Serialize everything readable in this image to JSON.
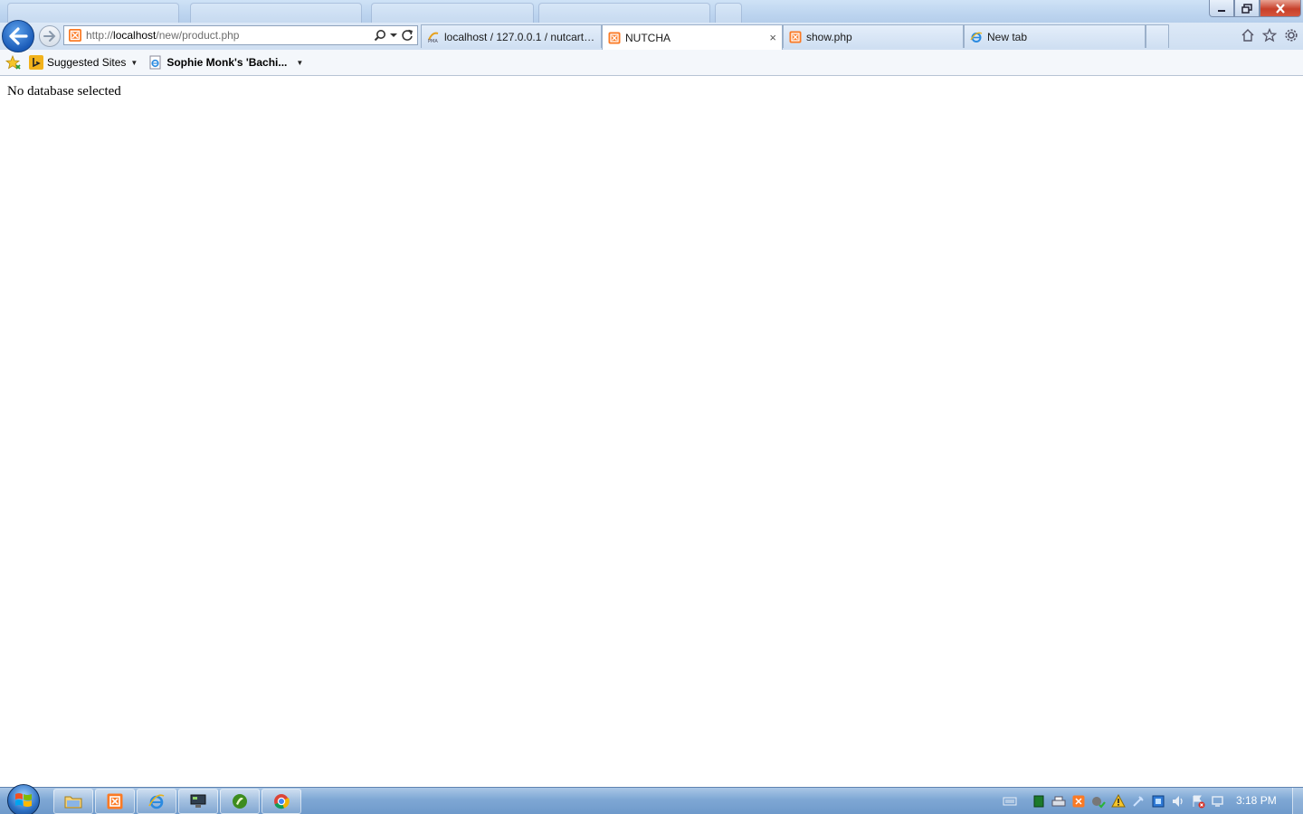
{
  "browser": {
    "background_tabs": [
      "",
      "",
      "",
      ""
    ],
    "address": {
      "scheme": "http://",
      "host": "localhost",
      "path": "/new/product.php"
    },
    "tabs": [
      {
        "label": "localhost / 127.0.0.1 / nutcart /...",
        "icon": "phpmyadmin-icon"
      },
      {
        "label": "NUTCHA",
        "icon": "xampp-icon",
        "close": "×",
        "active": true
      },
      {
        "label": "show.php",
        "icon": "xampp-icon"
      },
      {
        "label": "New tab",
        "icon": "ie-icon"
      }
    ],
    "favorites": [
      {
        "label": "Suggested Sites",
        "icon": "bing-icon"
      },
      {
        "label": "Sophie Monk's 'Bachi...",
        "icon": "ie-page-icon"
      }
    ],
    "colors": {
      "accent": "#1a5bb8",
      "close": "#c7402a"
    }
  },
  "page": {
    "message": "No database selected"
  },
  "taskbar": {
    "apps": [
      "explorer-icon",
      "xampp-icon",
      "ie-icon",
      "monitor-icon",
      "dreamweaver-icon",
      "chrome-icon"
    ],
    "clock": "3:18 PM"
  }
}
